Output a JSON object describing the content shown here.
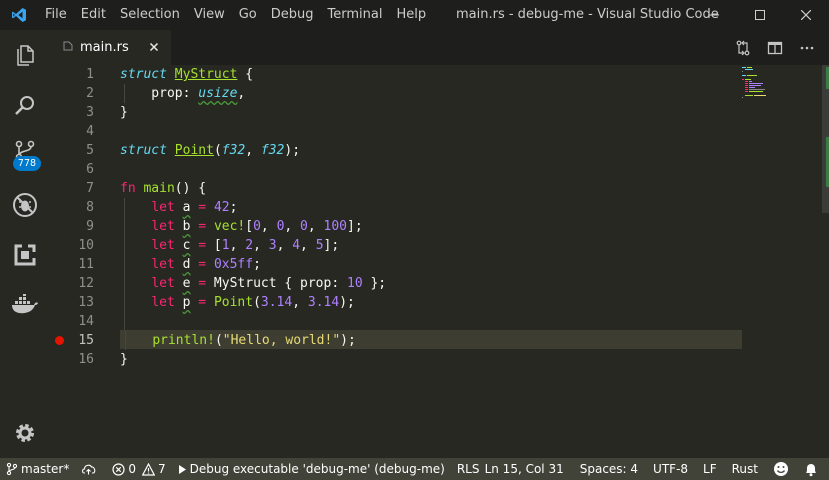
{
  "titlebar": {
    "menu": [
      "File",
      "Edit",
      "Selection",
      "View",
      "Go",
      "Debug",
      "Terminal",
      "Help"
    ],
    "title": "main.rs - debug-me - Visual Studio Code"
  },
  "activity": {
    "scm_badge": "778"
  },
  "tabs": [
    {
      "icon": "rs",
      "label": "main.rs"
    }
  ],
  "editor": {
    "active_line": 15,
    "breakpoint_line": 15,
    "line_numbers": [
      "1",
      "2",
      "3",
      "4",
      "5",
      "6",
      "7",
      "8",
      "9",
      "10",
      "11",
      "12",
      "13",
      "14",
      "15",
      "16"
    ]
  },
  "status": {
    "branch": "master*",
    "errors": "0",
    "warnings": "7",
    "debug": "Debug executable 'debug-me' (debug-me)",
    "rls": "RLS",
    "position": "Ln 15, Col 31",
    "spaces": "Spaces: 4",
    "encoding": "UTF-8",
    "eol": "LF",
    "language": "Rust"
  },
  "colors": {
    "titlebar": "#1e1f1c",
    "editor_bg": "#272822",
    "statusbar": "#414339",
    "badge": "#007acc",
    "breakpoint": "#e51400"
  }
}
